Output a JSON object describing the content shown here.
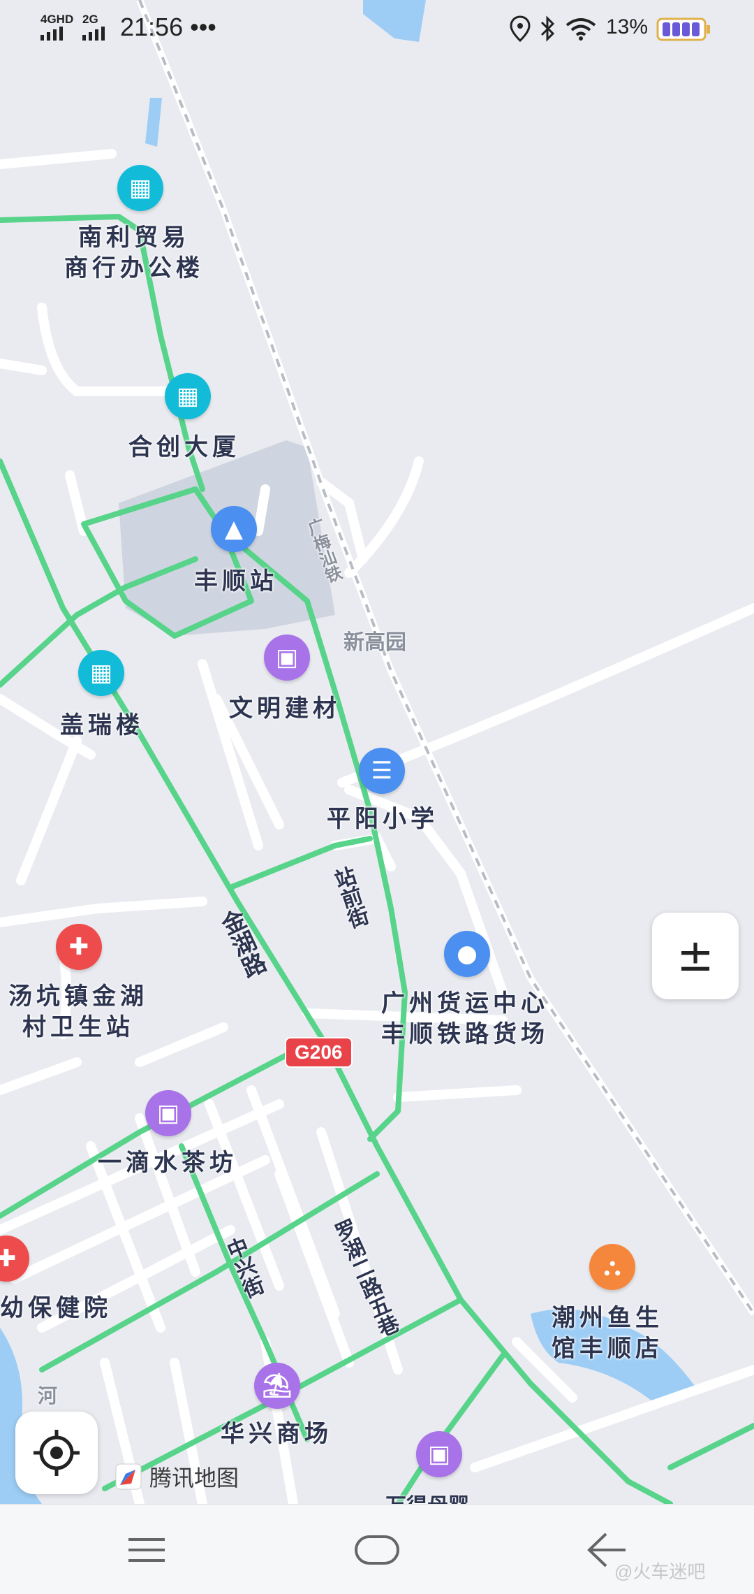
{
  "status_bar": {
    "signal1": "4GHD",
    "signal2": "2G",
    "time": "21:56 •••",
    "battery_percent": "13%"
  },
  "pois": [
    {
      "label": "南利贸易\n商行办公楼",
      "icon": "office-building-icon",
      "color": "#12bcd8"
    },
    {
      "label": "合创大厦",
      "icon": "office-building-icon",
      "color": "#12bcd8"
    },
    {
      "label": "丰顺站",
      "icon": "train-station-icon",
      "color": "#4b8ff0"
    },
    {
      "label": "文明建材",
      "icon": "shopping-bag-icon",
      "color": "#a873e8"
    },
    {
      "label": "盖瑞楼",
      "icon": "office-building-icon",
      "color": "#12bcd8"
    },
    {
      "label": "平阳小学",
      "icon": "book-icon",
      "color": "#4b8ff0"
    },
    {
      "label": "汤坑镇金湖\n村卫生站",
      "icon": "medical-cross-icon",
      "color": "#ee4c4c"
    },
    {
      "label": "广州货运中心\n丰顺铁路货场",
      "icon": "location-pin-icon",
      "color": "#4b8ff0"
    },
    {
      "label": "一滴水茶坊",
      "icon": "shopping-bag-icon",
      "color": "#a873e8"
    },
    {
      "label": "幼保健院",
      "icon": "medical-cross-icon",
      "color": "#ee4c4c"
    },
    {
      "label": "潮州鱼生\n馆丰顺店",
      "icon": "restaurant-icon",
      "color": "#f5873c"
    },
    {
      "label": "华兴商场",
      "icon": "shopping-cart-icon",
      "color": "#a873e8"
    },
    {
      "label": "",
      "icon": "shopping-bag-icon",
      "color": "#a873e8"
    }
  ],
  "road_labels": {
    "railway": "广梅汕铁",
    "xingaoyuan": "新高园",
    "jinhu_road": "金湖路",
    "zhanqian_street": "站前街",
    "zhongxing_street": "中兴街",
    "luohu_lane": "罗湖二路五巷",
    "river": "河",
    "bottom_partial": "万得母婴"
  },
  "highway_badge": "G206",
  "zoom_control_label": "±",
  "brand_name": "腾讯地图",
  "watermark": "@火车迷吧",
  "colors": {
    "map_bg": "#e9ebf0",
    "road": "#ffffff",
    "traffic_green": "#57d38a",
    "station_area": "#cfd5e0",
    "water": "#9dcdf5",
    "railway": "#b8bcc4"
  }
}
